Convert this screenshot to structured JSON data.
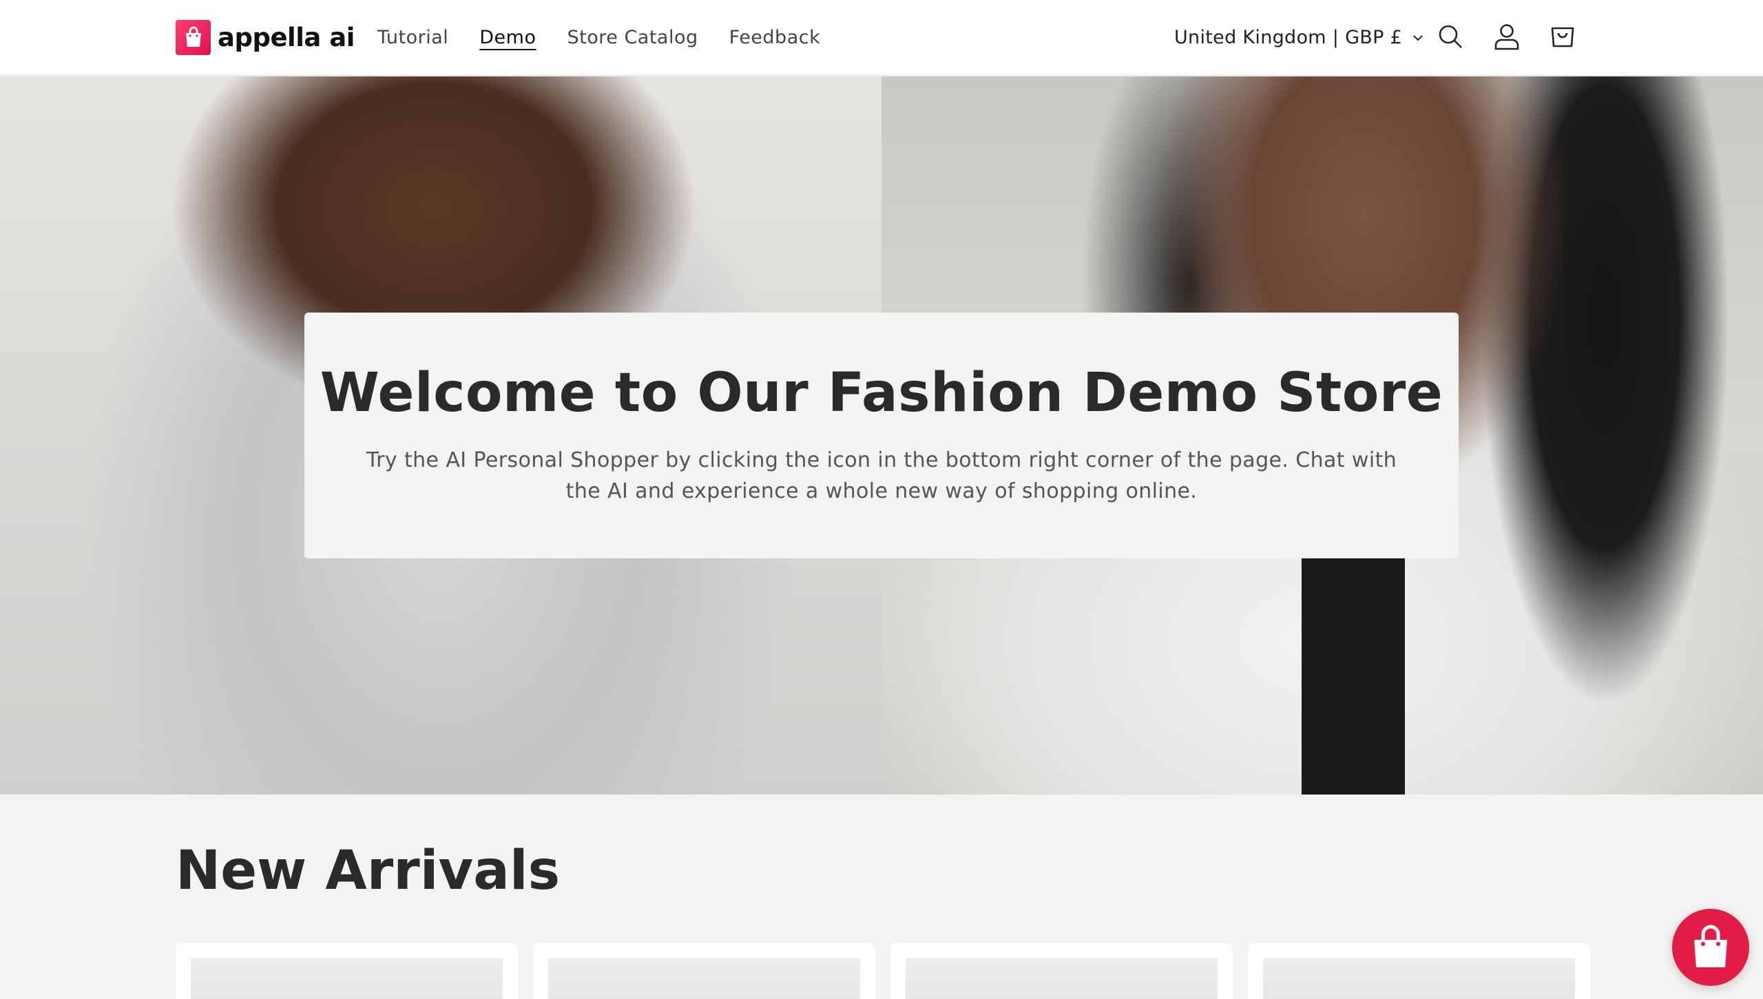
{
  "brand": {
    "name": "appella ai",
    "accent": "#e31c47"
  },
  "nav": {
    "items": [
      {
        "label": "Tutorial",
        "active": false
      },
      {
        "label": "Demo",
        "active": true
      },
      {
        "label": "Store Catalog",
        "active": false
      },
      {
        "label": "Feedback",
        "active": false
      }
    ]
  },
  "header": {
    "locale": "United Kingdom | GBP £",
    "icons": [
      "search-icon",
      "account-icon",
      "cart-icon"
    ]
  },
  "hero": {
    "title": "Welcome to Our Fashion Demo Store",
    "subtitle": "Try the AI Personal Shopper by clicking the icon in the bottom right corner of the page. Chat with the AI and experience a whole new way of shopping online."
  },
  "new_arrivals": {
    "title": "New Arrivals",
    "product_count_visible": 4
  },
  "chat_widget": {
    "icon": "shopping-bag-icon"
  }
}
